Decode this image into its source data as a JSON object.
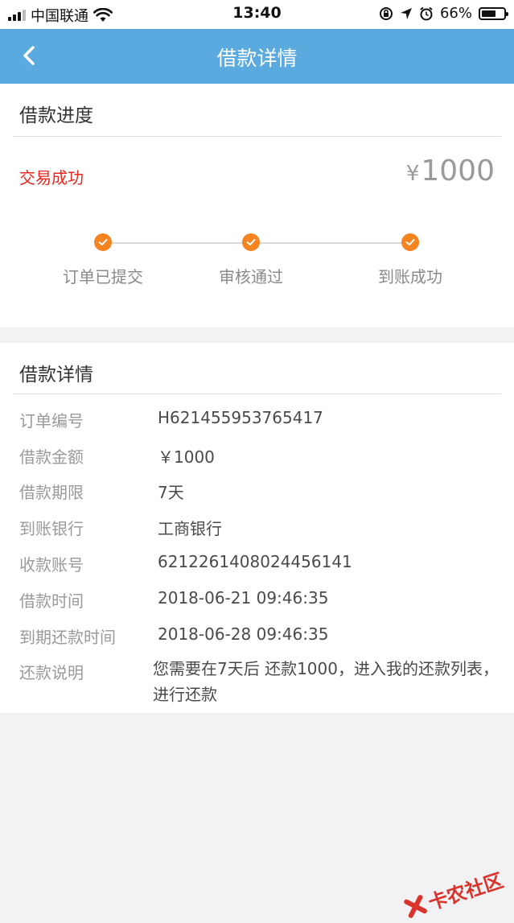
{
  "status_bar": {
    "carrier": "中国联通",
    "time": "13:40",
    "battery_text": "66%",
    "battery_level": 0.66
  },
  "nav": {
    "title": "借款详情"
  },
  "progress": {
    "section_title": "借款进度",
    "status": "交易成功",
    "currency": "¥",
    "amount": "1000",
    "steps": [
      {
        "label": "订单已提交"
      },
      {
        "label": "审核通过"
      },
      {
        "label": "到账成功"
      }
    ]
  },
  "detail": {
    "section_title": "借款详情",
    "rows": [
      {
        "label": "订单编号",
        "value": "H621455953765417"
      },
      {
        "label": "借款金额",
        "value": "￥1000"
      },
      {
        "label": "借款期限",
        "value": "7天"
      },
      {
        "label": "到账银行",
        "value": "工商银行"
      },
      {
        "label": "收款账号",
        "value": "6212261408024456141"
      },
      {
        "label": "借款时间",
        "value": "2018-06-21 09:46:35"
      },
      {
        "label": "到期还款时间",
        "value": "2018-06-28 09:46:35"
      },
      {
        "label": "还款说明",
        "value": "您需要在7天后 还款1000，进入我的还款列表，进行还款"
      }
    ]
  },
  "watermark": {
    "text": "卡农社区"
  },
  "colors": {
    "nav_bg": "#5aaae0",
    "status_red": "#e8261e",
    "step_orange": "#f5831f"
  }
}
